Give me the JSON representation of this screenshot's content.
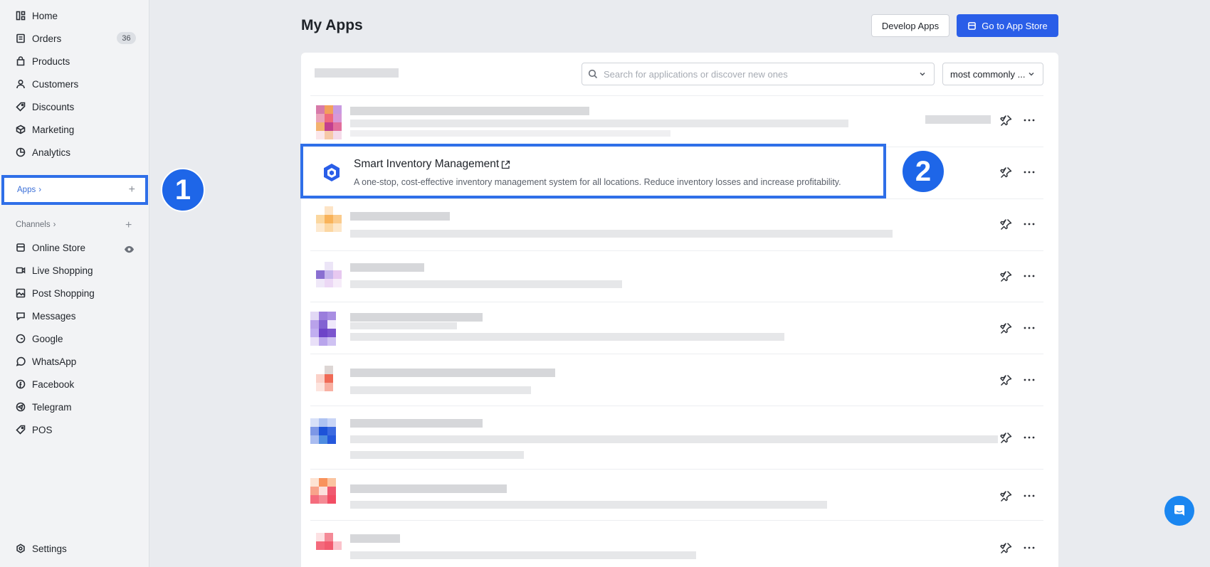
{
  "sidebar": {
    "nav": [
      {
        "label": "Home",
        "icon": "home-icon"
      },
      {
        "label": "Orders",
        "icon": "orders-icon",
        "badge": "36"
      },
      {
        "label": "Products",
        "icon": "products-icon"
      },
      {
        "label": "Customers",
        "icon": "customers-icon"
      },
      {
        "label": "Discounts",
        "icon": "discounts-icon"
      },
      {
        "label": "Marketing",
        "icon": "marketing-icon"
      },
      {
        "label": "Analytics",
        "icon": "analytics-icon"
      }
    ],
    "apps_label": "Apps",
    "channels_label": "Channels",
    "channels": [
      {
        "label": "Online Store",
        "icon": "store-icon"
      },
      {
        "label": "Live Shopping",
        "icon": "video-icon"
      },
      {
        "label": "Post Shopping",
        "icon": "image-icon"
      },
      {
        "label": "Messages",
        "icon": "chat-icon"
      },
      {
        "label": "Google",
        "icon": "google-icon"
      },
      {
        "label": "WhatsApp",
        "icon": "whatsapp-icon"
      },
      {
        "label": "Facebook",
        "icon": "facebook-icon"
      },
      {
        "label": "Telegram",
        "icon": "telegram-icon"
      },
      {
        "label": "POS",
        "icon": "pos-icon"
      }
    ],
    "settings_label": "Settings"
  },
  "callouts": {
    "one": "1",
    "two": "2"
  },
  "header": {
    "title": "My Apps",
    "develop_button": "Develop Apps",
    "store_button": "Go to App Store"
  },
  "toolbar": {
    "search_placeholder": "Search for applications or discover new ones",
    "sort_value": "most commonly ..."
  },
  "featured_app": {
    "name": "Smart Inventory Management",
    "description": "A one-stop, cost-effective inventory management system for all locations. Reduce inventory losses and increase profitability."
  },
  "colors": {
    "accent": "#2a5ee8",
    "highlight_border": "#2f6fe8",
    "callout": "#1e66e8"
  }
}
